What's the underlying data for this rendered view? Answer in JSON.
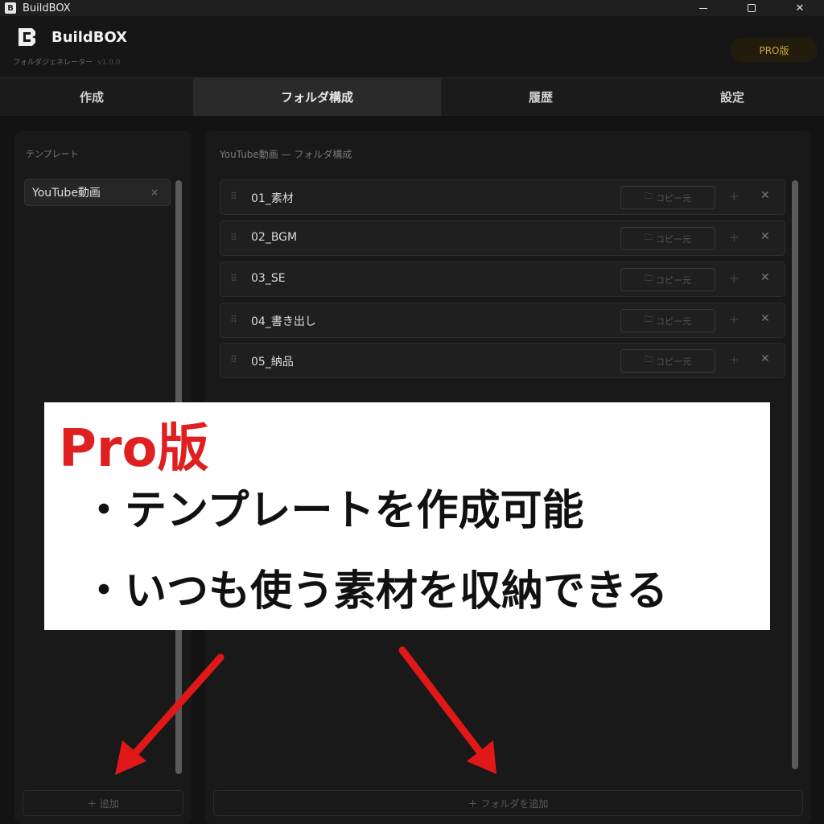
{
  "window": {
    "title": "BuildBOX"
  },
  "header": {
    "brand_name": "BuildBOX",
    "subtitle": "フォルダジェネレーター",
    "version": "v1.0.0",
    "pro_badge": "PRO版"
  },
  "tabs": [
    {
      "label": "作成",
      "active": false
    },
    {
      "label": "フォルダ構成",
      "active": true
    },
    {
      "label": "履歴",
      "active": false
    },
    {
      "label": "設定",
      "active": false
    }
  ],
  "templates": {
    "title": "テンプレート",
    "items": [
      {
        "label": "YouTube動画",
        "close": "×"
      }
    ],
    "add_button": "＋ 追加"
  },
  "folders": {
    "title": "YouTube動画 — フォルダ構成",
    "rows": [
      {
        "name": "01_素材",
        "copy_label": "コピー元"
      },
      {
        "name": "02_BGM",
        "copy_label": "コピー元"
      },
      {
        "name": "03_SE",
        "copy_label": "コピー元"
      },
      {
        "name": "04_書き出し",
        "copy_label": "コピー元"
      },
      {
        "name": "05_納品",
        "copy_label": "コピー元"
      }
    ],
    "add_button": "＋ フォルダを追加"
  },
  "callout": {
    "heading": "Pro版",
    "lines": [
      "・テンプレートを作成可能",
      "・いつも使う素材を収納できる"
    ]
  },
  "colors": {
    "accent_red": "#e02020",
    "pro_gold": "#d4a63c"
  }
}
